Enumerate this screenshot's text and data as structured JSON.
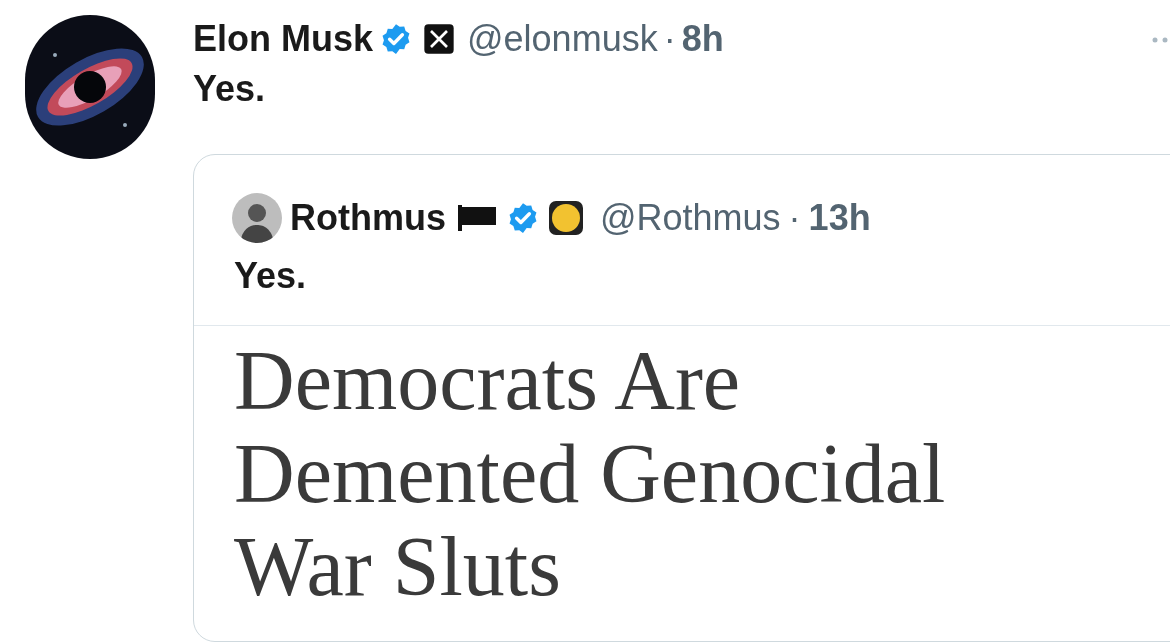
{
  "post": {
    "author": {
      "name": "Elon Musk",
      "verified": true,
      "handle": "@elonmusk",
      "separator": "·",
      "time": "8h"
    },
    "text": "Yes.",
    "quote": {
      "author": {
        "name": "Rothmus",
        "verified": true,
        "handle": "@Rothmus",
        "separator": "·",
        "time": "13h"
      },
      "text": "Yes.",
      "article": {
        "title": "Democrats Are Demented Genocidal War Sluts"
      }
    }
  }
}
